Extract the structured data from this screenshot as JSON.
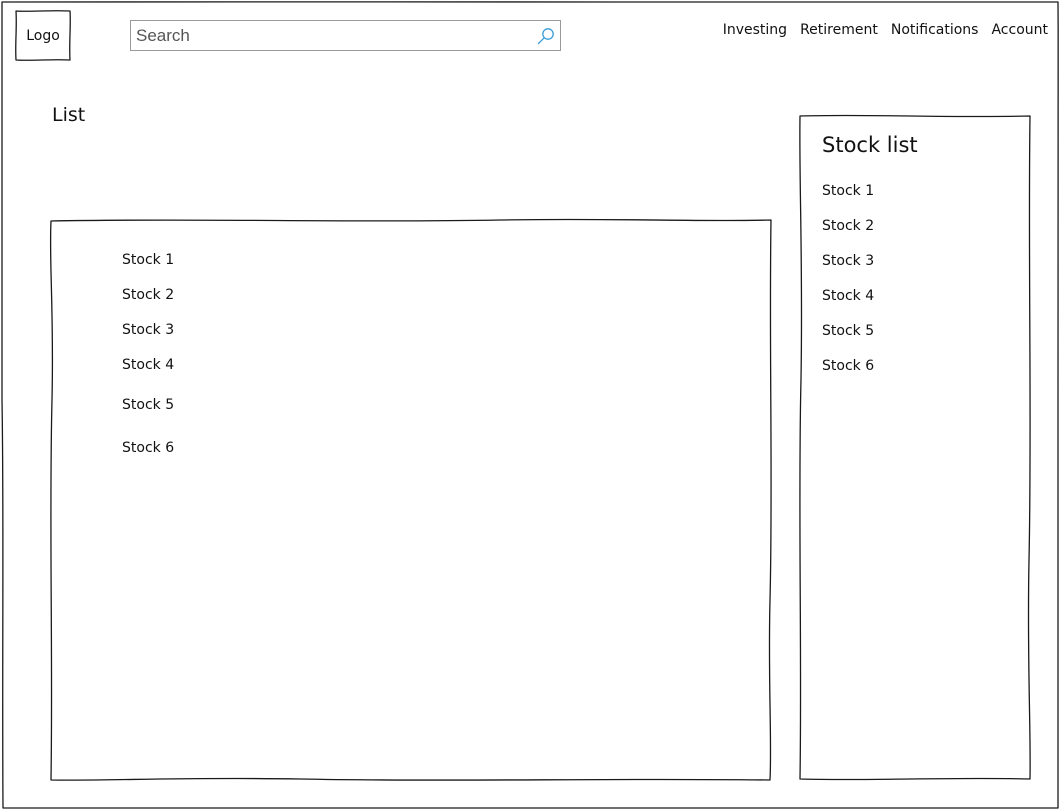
{
  "header": {
    "logo_label": "Logo",
    "search": {
      "placeholder": "Search",
      "value": ""
    },
    "nav": [
      "Investing",
      "Retirement",
      "Notifications",
      "Account"
    ]
  },
  "main": {
    "title": "List",
    "items": [
      "Stock 1",
      "Stock 2",
      "Stock 3",
      "Stock 4",
      "Stock 5",
      "Stock 6"
    ]
  },
  "sidebar": {
    "title": "Stock list",
    "items": [
      "Stock 1",
      "Stock 2",
      "Stock 3",
      "Stock 4",
      "Stock 5",
      "Stock 6"
    ]
  },
  "colors": {
    "stroke": "#1a1a1a",
    "search_border": "#9a9a9a",
    "search_icon": "#3a9fd6",
    "background": "#ffffff"
  },
  "icons": {
    "search": "magnifier-icon"
  }
}
